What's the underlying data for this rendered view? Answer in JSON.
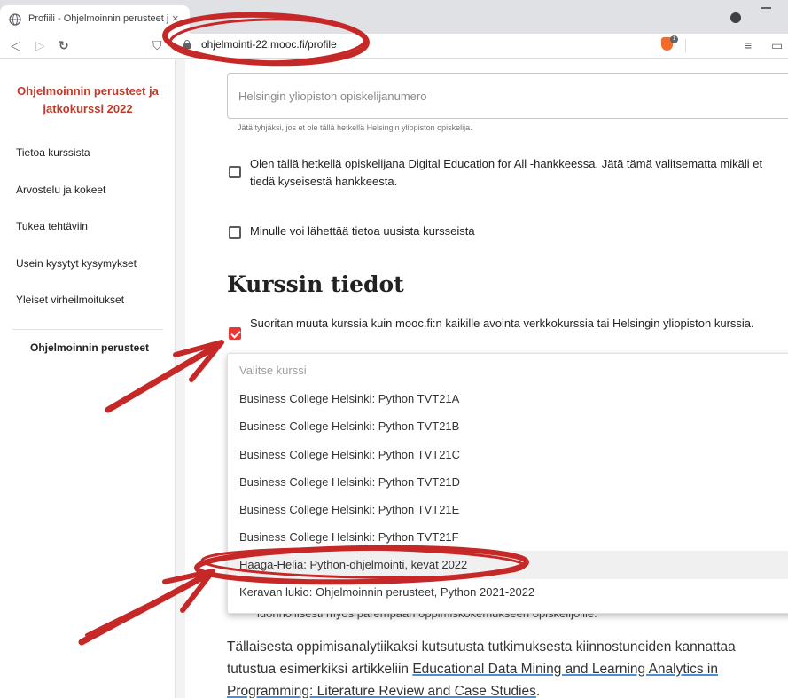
{
  "browser": {
    "tab_title": "Profiili - Ohjelmoinnin perusteet j",
    "tab_close": "×",
    "url": "ohjelmointi-22.mooc.fi/profile",
    "back_glyph": "◁",
    "forward_glyph": "▷",
    "reload_glyph": "↻",
    "bookmark_glyph": "⛉",
    "brave_badge": "1",
    "playlist_glyph": "≡",
    "wallet_glyph": "▭"
  },
  "sidebar": {
    "course_title": "Ohjelmoinnin perusteet ja jatkokurssi 2022",
    "items": [
      {
        "label": "Tietoa kurssista"
      },
      {
        "label": "Arvostelu ja kokeet"
      },
      {
        "label": "Tukea tehtäviin"
      },
      {
        "label": "Usein kysytyt kysymykset"
      },
      {
        "label": "Yleiset virheilmoitukset"
      }
    ],
    "part_label": "Ohjelmoinnin perusteet"
  },
  "form": {
    "student_number_placeholder": "Helsingin yliopiston opiskelijanumero",
    "student_number_helper": "Jätä tyhjäksi, jos et ole tällä hetkellä Helsingin yliopiston opiskelija.",
    "digital_education_label": "Olen tällä hetkellä opiskelijana Digital Education for All -hankkeessa. Jätä tämä valitsematta mikäli et tiedä kyseisestä hankkeesta.",
    "digital_education_checked": false,
    "newsletter_label": "Minulle voi lähettää tietoa uusista kursseista",
    "newsletter_checked": false
  },
  "course_info": {
    "heading": "Kurssin tiedot",
    "other_course_label": "Suoritan muuta kurssia kuin mooc.fi:n kaikille avointa verkkokurssia tai Helsingin yliopiston kurssia.",
    "other_course_checked": true,
    "dropdown": {
      "placeholder": "Valitse kurssi",
      "options": [
        "Business College Helsinki: Python TVT21A",
        "Business College Helsinki: Python TVT21B",
        "Business College Helsinki: Python TVT21C",
        "Business College Helsinki: Python TVT21D",
        "Business College Helsinki: Python TVT21E",
        "Business College Helsinki: Python TVT21F",
        "Haaga-Helia: Python-ohjelmointi, kevät 2022",
        "Keravan lukio: Ohjelmoinnin perusteet, Python 2021-2022"
      ],
      "hovered_option": "Haaga-Helia: Python-ohjelmointi, kevät 2022"
    },
    "behind_text": "luonnollisesti myös parempaan oppimiskokemukseen opiskelijoille."
  },
  "research_paragraph": {
    "text_before": "Tällaisesta oppimisanalytiikaksi kutsutusta tutkimuksesta kiinnostuneiden kannattaa tutustua esimerkiksi artikkeliin ",
    "link_text": "Educational Data Mining and Learning Analytics in Programming: Literature Review and Case Studies",
    "text_after": "."
  },
  "colors": {
    "accent_red": "#e53935",
    "course_title_red": "#c0392b",
    "annotation_red": "#c62828",
    "link_underline": "#4a90d9"
  }
}
